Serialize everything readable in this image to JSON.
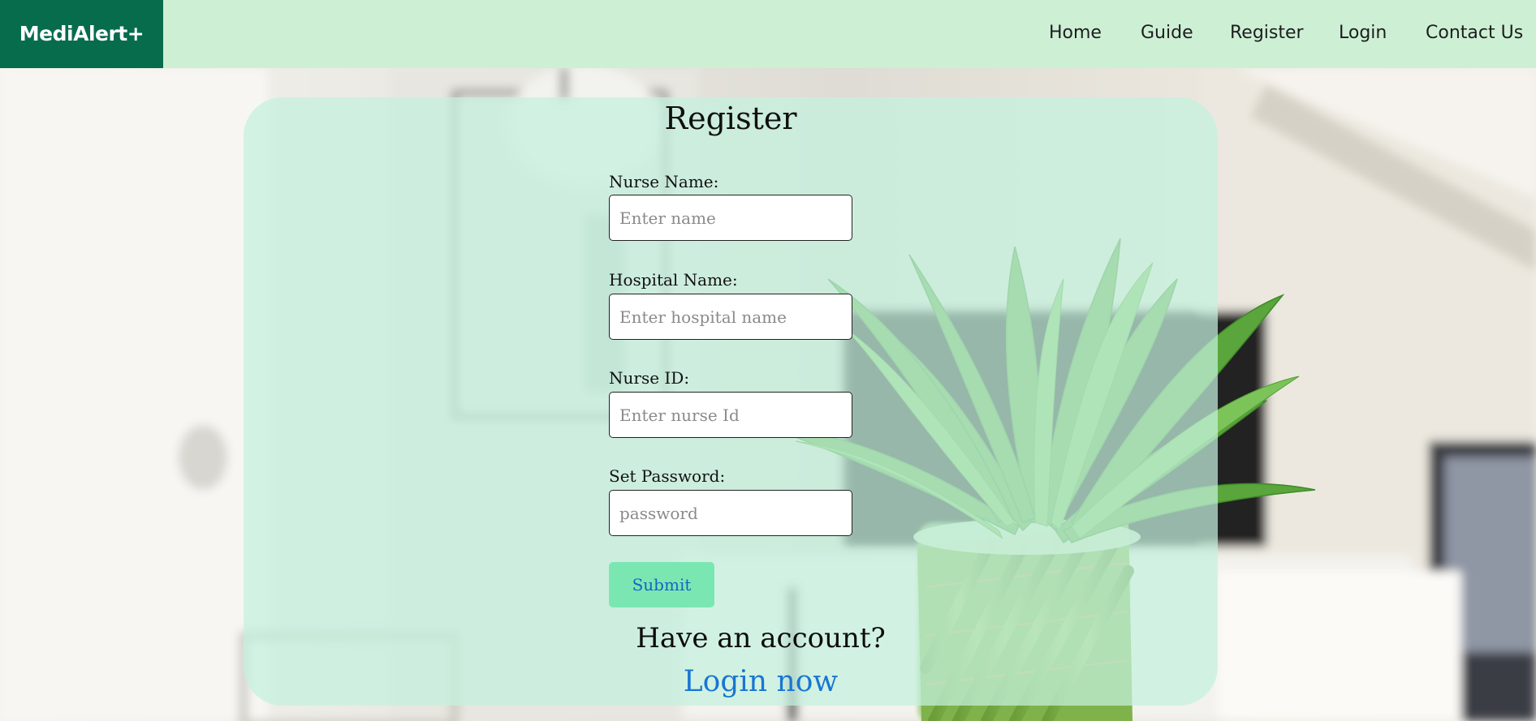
{
  "navbar": {
    "brand": "MediAlert+",
    "items": [
      {
        "label": "Home"
      },
      {
        "label": "Guide"
      },
      {
        "label": "Register"
      },
      {
        "label": "Login"
      },
      {
        "label": "Contact Us"
      }
    ]
  },
  "form": {
    "title": "Register",
    "fields": [
      {
        "label": "Nurse Name:",
        "placeholder": "Enter name",
        "value": ""
      },
      {
        "label": "Hospital Name:",
        "placeholder": "Enter hospital name",
        "value": ""
      },
      {
        "label": "Nurse ID:",
        "placeholder": "Enter nurse Id",
        "value": ""
      },
      {
        "label": "Set Password:",
        "placeholder": "password",
        "value": ""
      }
    ],
    "submit_label": "Submit",
    "account_prompt": "Have an account?",
    "login_link": "Login now"
  },
  "colors": {
    "brand_bg": "#066c4c",
    "navbar_bg": "#cdf0d5",
    "card_bg": "#c3f1de",
    "submit_bg": "#7ae7b3",
    "link": "#1976d2"
  }
}
